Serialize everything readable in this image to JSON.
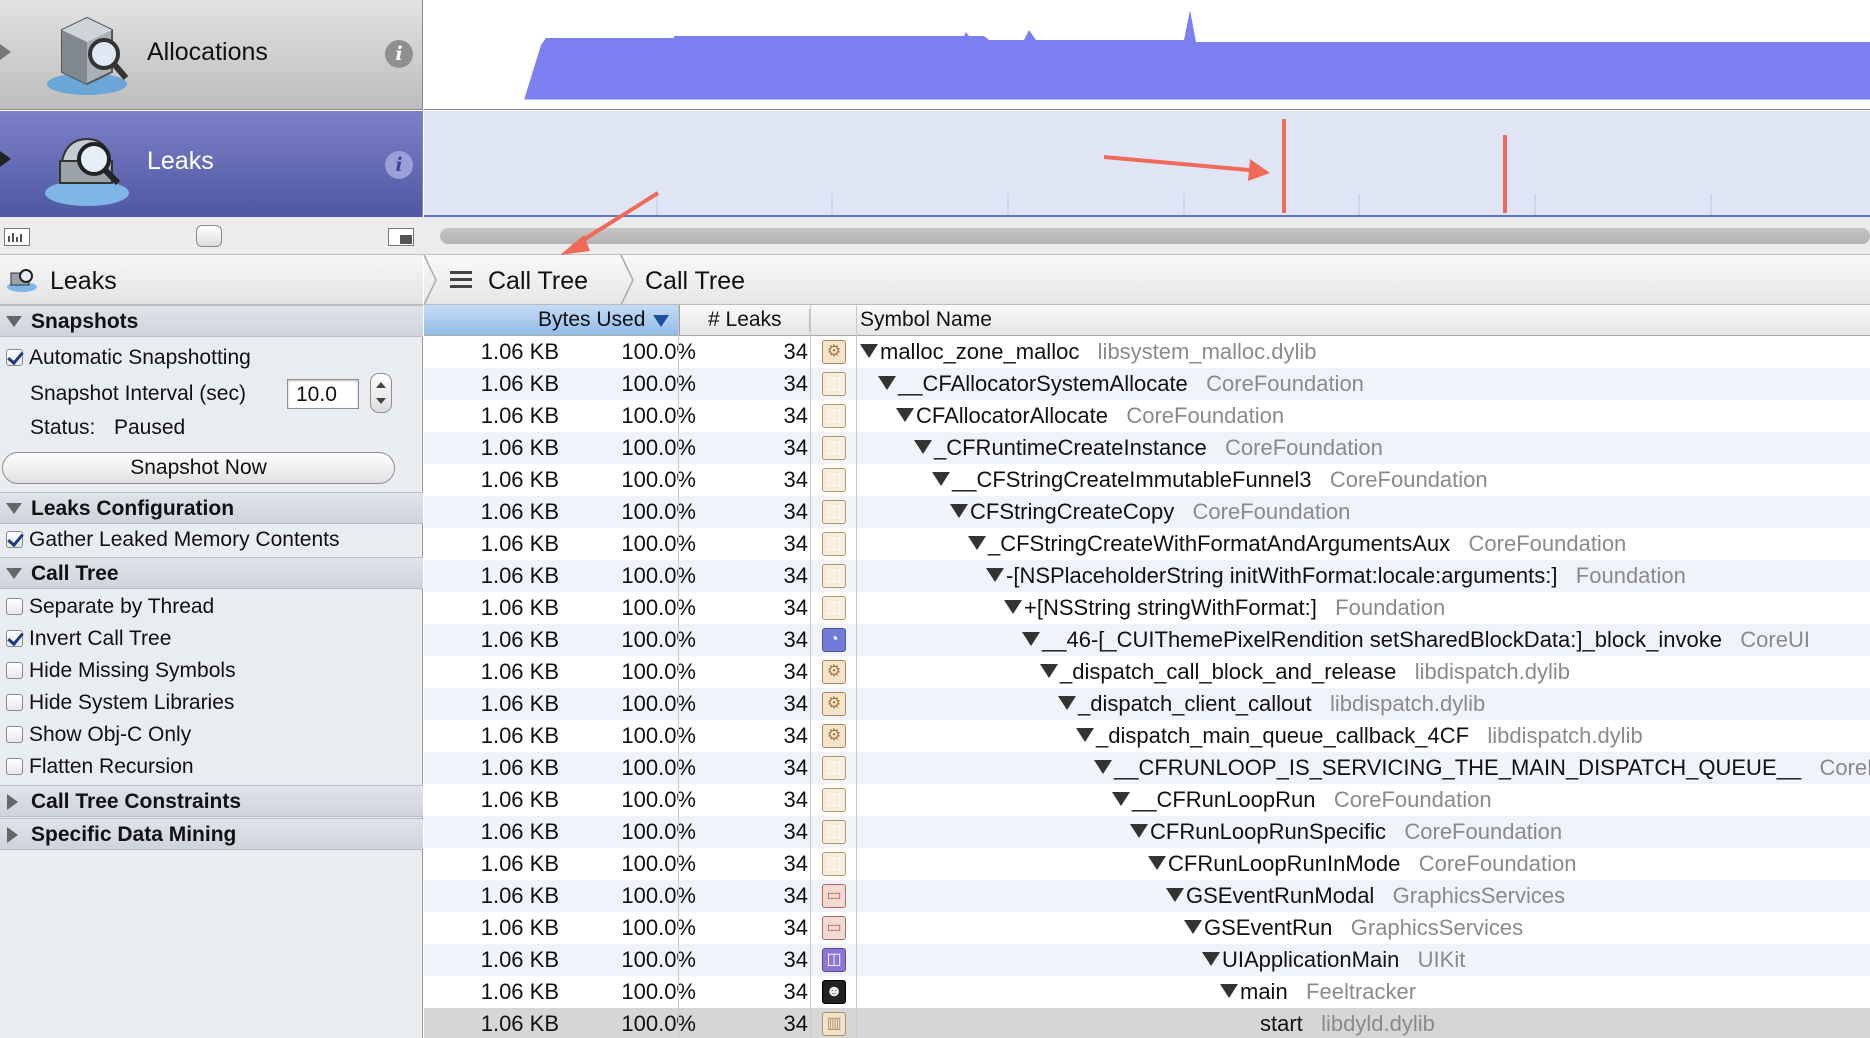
{
  "instruments": [
    {
      "name": "Allocations",
      "icon": "allocations-icon",
      "info": "i"
    },
    {
      "name": "Leaks",
      "icon": "leaks-icon",
      "info": "i"
    }
  ],
  "left_panel": {
    "title": "Leaks",
    "sections": {
      "snapshots": "Snapshots",
      "leaks_config": "Leaks Configuration",
      "call_tree": "Call Tree",
      "constraints": "Call Tree Constraints",
      "data_mining": "Specific Data Mining"
    },
    "automatic_snapshotting": "Automatic Snapshotting",
    "snapshot_interval_label": "Snapshot Interval (sec)",
    "snapshot_interval_value": "10.0",
    "status_label": "Status:",
    "status_value": "Paused",
    "snapshot_now": "Snapshot Now",
    "gather_leaked": "Gather Leaked Memory Contents",
    "options": [
      {
        "label": "Separate by Thread",
        "checked": false
      },
      {
        "label": "Invert Call Tree",
        "checked": true
      },
      {
        "label": "Hide Missing Symbols",
        "checked": false
      },
      {
        "label": "Hide System Libraries",
        "checked": false
      },
      {
        "label": "Show Obj-C Only",
        "checked": false
      },
      {
        "label": "Flatten Recursion",
        "checked": false
      }
    ]
  },
  "breadcrumb": {
    "first": "Call Tree",
    "second": "Call Tree"
  },
  "columns": {
    "bytes_used": "Bytes Used",
    "leaks": "# Leaks",
    "symbol": "Symbol Name"
  },
  "rows": [
    {
      "bytes": "1.06 KB",
      "pct": "100.0%",
      "leaks": "34",
      "icon": "gear",
      "symbol": "malloc_zone_malloc",
      "library": "libsystem_malloc.dylib"
    },
    {
      "bytes": "1.06 KB",
      "pct": "100.0%",
      "leaks": "34",
      "icon": "cup",
      "symbol": "__CFAllocatorSystemAllocate",
      "library": "CoreFoundation"
    },
    {
      "bytes": "1.06 KB",
      "pct": "100.0%",
      "leaks": "34",
      "icon": "cup",
      "symbol": "CFAllocatorAllocate",
      "library": "CoreFoundation"
    },
    {
      "bytes": "1.06 KB",
      "pct": "100.0%",
      "leaks": "34",
      "icon": "cup",
      "symbol": "_CFRuntimeCreateInstance",
      "library": "CoreFoundation"
    },
    {
      "bytes": "1.06 KB",
      "pct": "100.0%",
      "leaks": "34",
      "icon": "cup",
      "symbol": "__CFStringCreateImmutableFunnel3",
      "library": "CoreFoundation"
    },
    {
      "bytes": "1.06 KB",
      "pct": "100.0%",
      "leaks": "34",
      "icon": "cup",
      "symbol": "CFStringCreateCopy",
      "library": "CoreFoundation"
    },
    {
      "bytes": "1.06 KB",
      "pct": "100.0%",
      "leaks": "34",
      "icon": "cup",
      "symbol": "_CFStringCreateWithFormatAndArgumentsAux",
      "library": "CoreFoundation"
    },
    {
      "bytes": "1.06 KB",
      "pct": "100.0%",
      "leaks": "34",
      "icon": "cup",
      "symbol": "-[NSPlaceholderString initWithFormat:locale:arguments:]",
      "library": "Foundation"
    },
    {
      "bytes": "1.06 KB",
      "pct": "100.0%",
      "leaks": "34",
      "icon": "cup",
      "symbol": "+[NSString stringWithFormat:]",
      "library": "Foundation"
    },
    {
      "bytes": "1.06 KB",
      "pct": "100.0%",
      "leaks": "34",
      "icon": "pie",
      "symbol": "__46-[_CUIThemePixelRendition setSharedBlockData:]_block_invoke",
      "library": "CoreUI"
    },
    {
      "bytes": "1.06 KB",
      "pct": "100.0%",
      "leaks": "34",
      "icon": "gear",
      "symbol": "_dispatch_call_block_and_release",
      "library": "libdispatch.dylib"
    },
    {
      "bytes": "1.06 KB",
      "pct": "100.0%",
      "leaks": "34",
      "icon": "gear",
      "symbol": "_dispatch_client_callout",
      "library": "libdispatch.dylib"
    },
    {
      "bytes": "1.06 KB",
      "pct": "100.0%",
      "leaks": "34",
      "icon": "gear",
      "symbol": "_dispatch_main_queue_callback_4CF",
      "library": "libdispatch.dylib"
    },
    {
      "bytes": "1.06 KB",
      "pct": "100.0%",
      "leaks": "34",
      "icon": "cup",
      "symbol": "__CFRUNLOOP_IS_SERVICING_THE_MAIN_DISPATCH_QUEUE__",
      "library": "CoreFou"
    },
    {
      "bytes": "1.06 KB",
      "pct": "100.0%",
      "leaks": "34",
      "icon": "cup",
      "symbol": "__CFRunLoopRun",
      "library": "CoreFoundation"
    },
    {
      "bytes": "1.06 KB",
      "pct": "100.0%",
      "leaks": "34",
      "icon": "cup",
      "symbol": "CFRunLoopRunSpecific",
      "library": "CoreFoundation"
    },
    {
      "bytes": "1.06 KB",
      "pct": "100.0%",
      "leaks": "34",
      "icon": "cup",
      "symbol": "CFRunLoopRunInMode",
      "library": "CoreFoundation"
    },
    {
      "bytes": "1.06 KB",
      "pct": "100.0%",
      "leaks": "34",
      "icon": "toolbox",
      "symbol": "GSEventRunModal",
      "library": "GraphicsServices"
    },
    {
      "bytes": "1.06 KB",
      "pct": "100.0%",
      "leaks": "34",
      "icon": "toolbox",
      "symbol": "GSEventRun",
      "library": "GraphicsServices"
    },
    {
      "bytes": "1.06 KB",
      "pct": "100.0%",
      "leaks": "34",
      "icon": "purple-cup",
      "symbol": "UIApplicationMain",
      "library": "UIKit"
    },
    {
      "bytes": "1.06 KB",
      "pct": "100.0%",
      "leaks": "34",
      "icon": "person",
      "symbol": "main",
      "library": "Feeltracker"
    },
    {
      "bytes": "1.06 KB",
      "pct": "100.0%",
      "leaks": "34",
      "icon": "building",
      "symbol": "start",
      "library": "libdyld.dylib"
    }
  ],
  "colors": {
    "allocations_graph": "#7b7ff0",
    "leak_spike": "#f06a5a",
    "annotation_arrow": "#f06a5a",
    "leaks_row_bg": "#5a60ad"
  }
}
